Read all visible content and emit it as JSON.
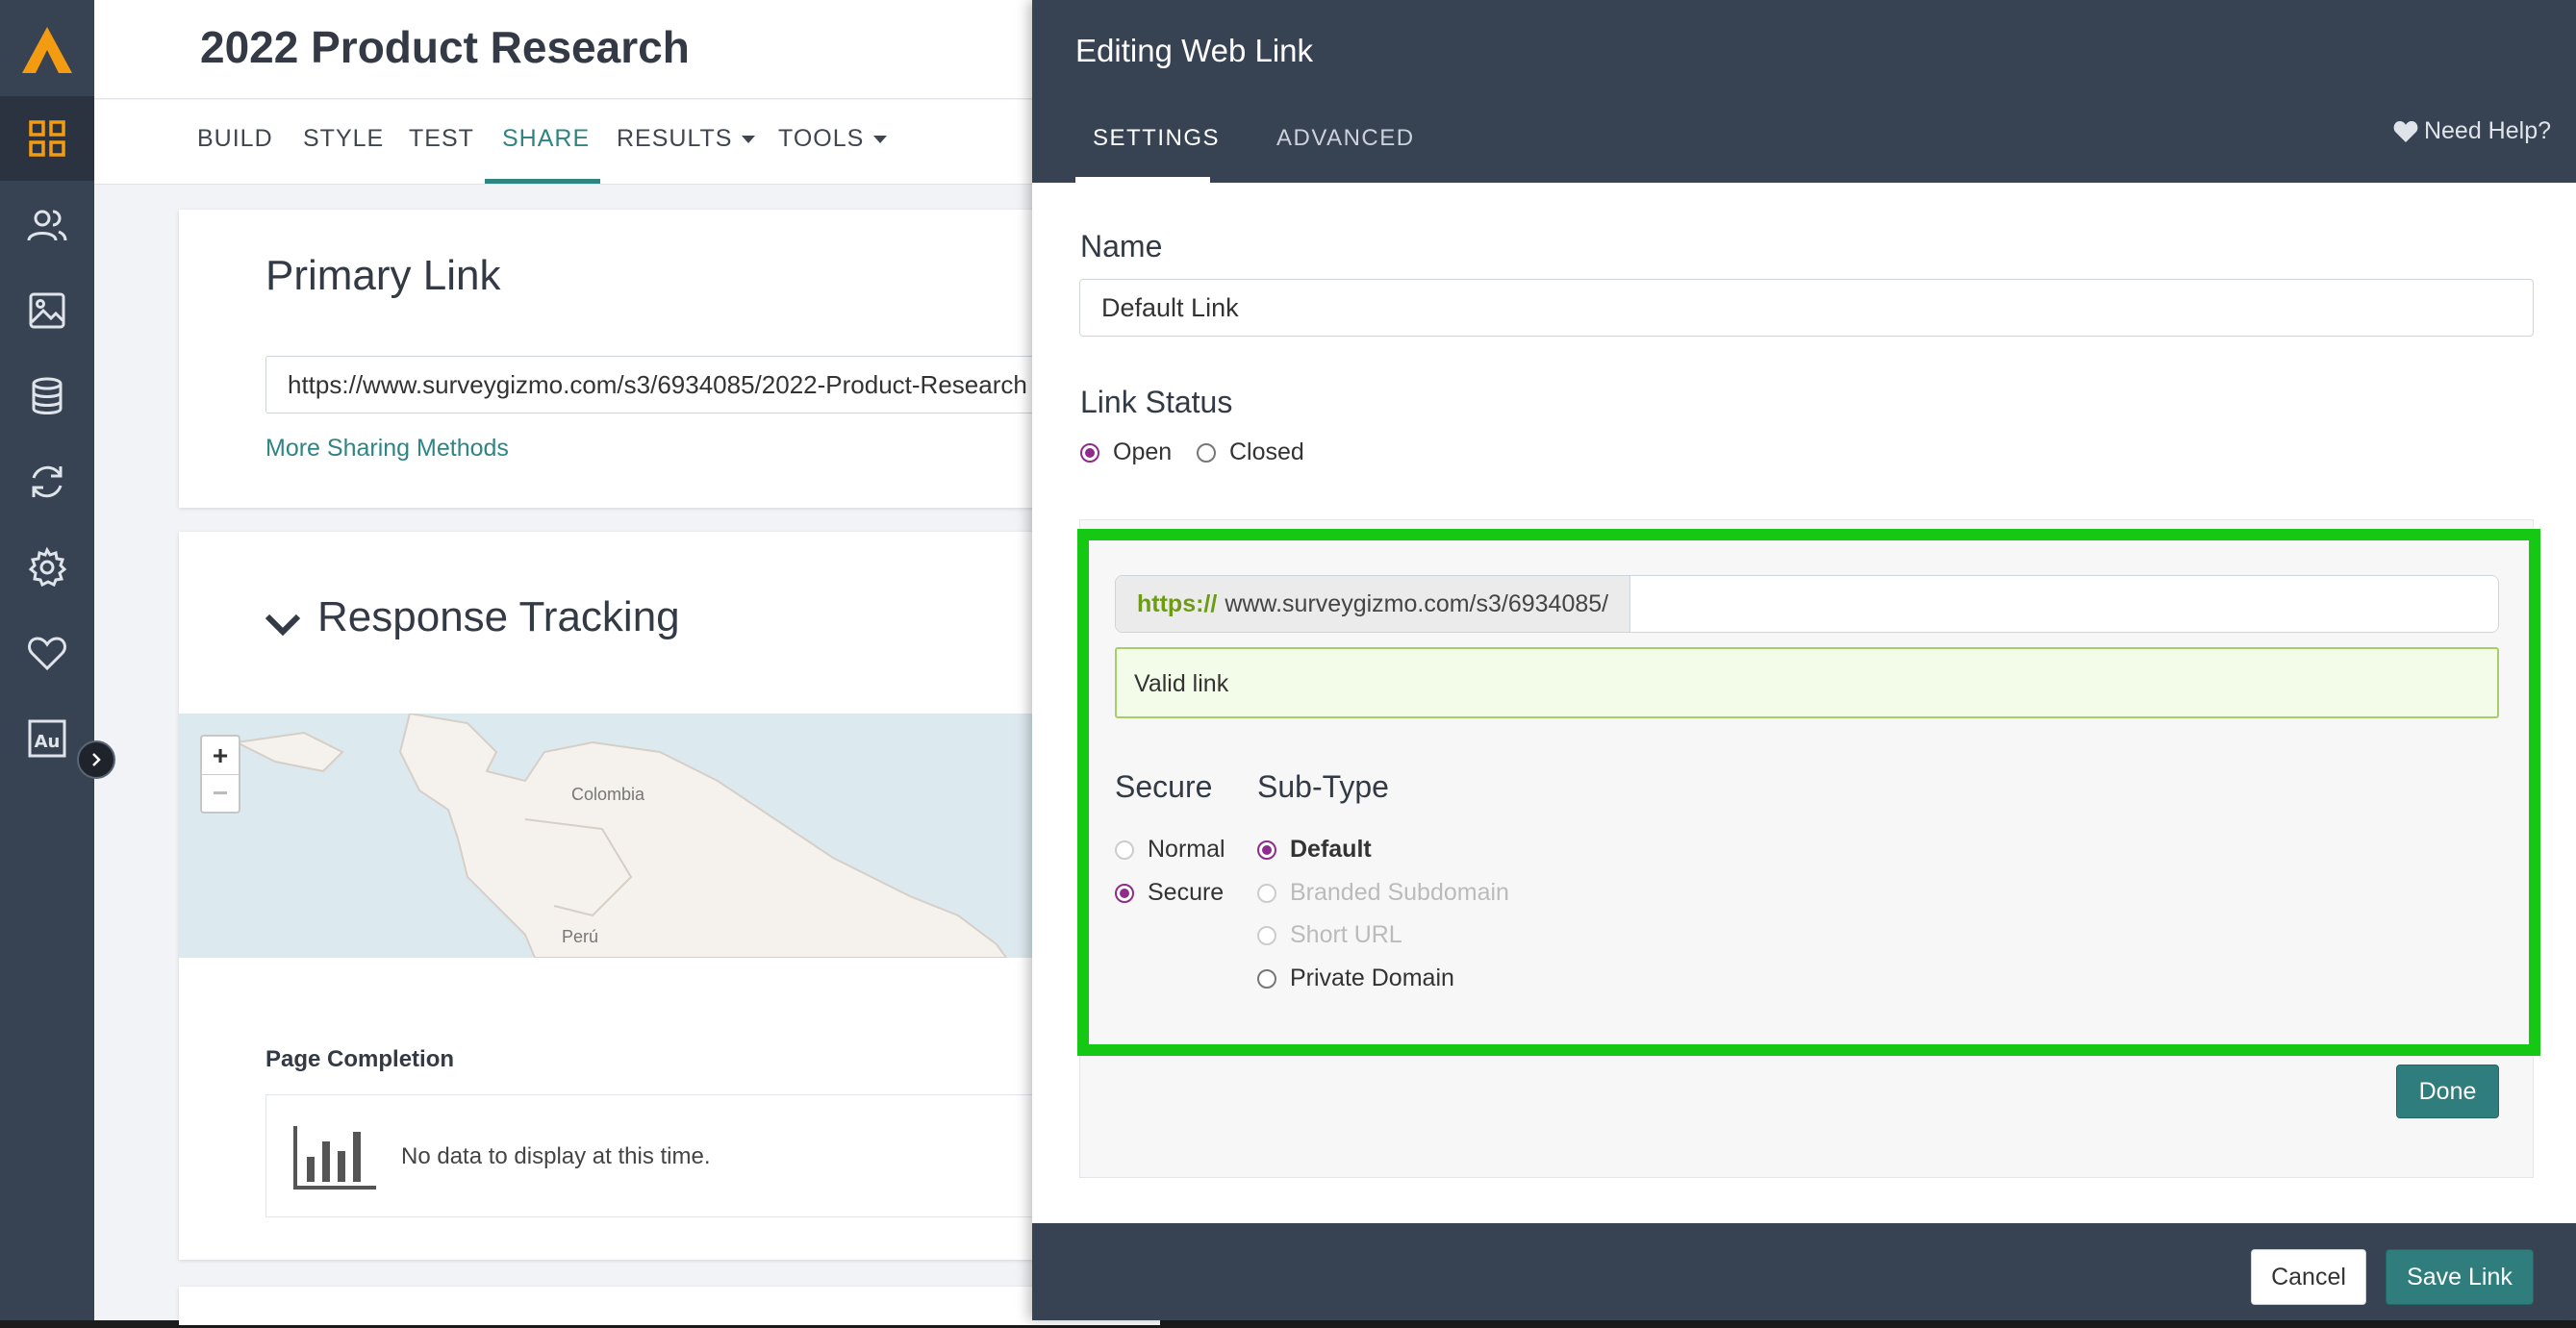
{
  "survey": {
    "title": "2022 Product Research"
  },
  "nav": {
    "tabs": [
      {
        "label": "BUILD"
      },
      {
        "label": "STYLE"
      },
      {
        "label": "TEST"
      },
      {
        "label": "SHARE"
      },
      {
        "label": "RESULTS"
      },
      {
        "label": "TOOLS"
      }
    ],
    "active_tab": "SHARE"
  },
  "sidebar": {
    "icons": [
      "logo-icon",
      "dashboard-grid-icon",
      "users-icon",
      "image-icon",
      "database-icon",
      "sync-icon",
      "gear-icon",
      "heart-icon",
      "au-text-icon"
    ]
  },
  "primary_link": {
    "title": "Primary Link",
    "url": "https://www.surveygizmo.com/s3/6934085/2022-Product-Research",
    "more_methods": "More Sharing Methods"
  },
  "response_tracking": {
    "title": "Response Tracking",
    "map_labels": {
      "colombia": "Colombia",
      "peru": "Perú"
    },
    "zoom_in": "+",
    "zoom_out": "−",
    "page_completion_label": "Page Completion",
    "empty_message": "No data to display at this time."
  },
  "panel": {
    "title": "Editing Web Link",
    "tabs": [
      {
        "label": "SETTINGS"
      },
      {
        "label": "ADVANCED"
      }
    ],
    "active_tab": "SETTINGS",
    "help": "Need Help?",
    "name_label": "Name",
    "name_value": "Default Link",
    "status_label": "Link Status",
    "status_options": [
      {
        "label": "Open",
        "checked": true
      },
      {
        "label": "Closed",
        "checked": false
      }
    ],
    "link": {
      "protocol": "https://",
      "base": "www.surveygizmo.com/s3/6934085/",
      "slug": ""
    },
    "validation": "Valid link",
    "secure_label": "Secure",
    "secure_options": [
      {
        "label": "Normal",
        "checked": false
      },
      {
        "label": "Secure",
        "checked": true
      }
    ],
    "subtype_label": "Sub-Type",
    "subtype_options": [
      {
        "label": "Default",
        "checked": true,
        "disabled": false
      },
      {
        "label": "Branded Subdomain",
        "checked": false,
        "disabled": true
      },
      {
        "label": "Short URL",
        "checked": false,
        "disabled": true
      },
      {
        "label": "Private Domain",
        "checked": false,
        "disabled": false
      }
    ],
    "done_label": "Done",
    "cancel_label": "Cancel",
    "save_label": "Save Link"
  },
  "colors": {
    "sidebar": "#374252",
    "accent_teal": "#2f8484",
    "radio_purple": "#8e2c8e",
    "highlight_green": "#14c814",
    "logo_orange": "#f39c12"
  }
}
